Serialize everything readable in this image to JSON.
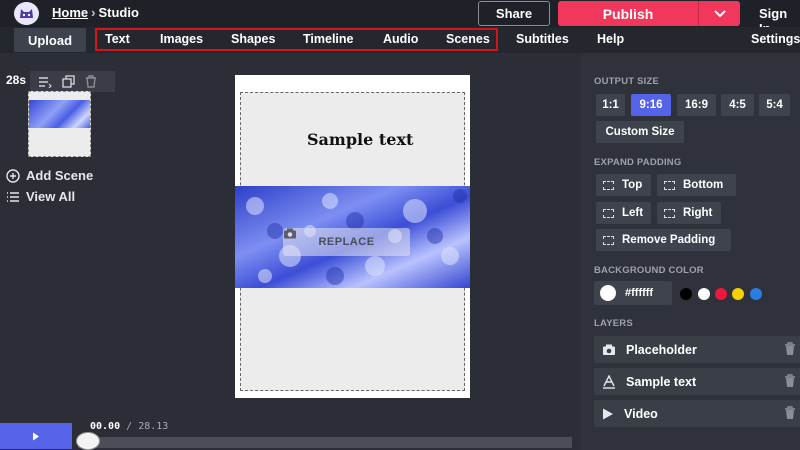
{
  "header": {
    "breadcrumb_home": "Home",
    "breadcrumb_separator": "›",
    "breadcrumb_current": "Studio",
    "share_label": "Share",
    "publish_label": "Publish",
    "signin_label": "Sign In"
  },
  "menu": {
    "upload_label": "Upload",
    "items": [
      "Text",
      "Images",
      "Shapes",
      "Timeline",
      "Audio",
      "Scenes",
      "Subtitles",
      "Help",
      "Settings"
    ]
  },
  "scenes": {
    "duration": "28s",
    "add_scene_label": "Add Scene",
    "view_all_label": "View All"
  },
  "canvas": {
    "sample_text": "Sample text",
    "replace_label": "REPLACE"
  },
  "timeline": {
    "current_time": "00.00",
    "separator": "/",
    "total_time": "28.13",
    "progress": 0
  },
  "right_panel": {
    "output_size_title": "OUTPUT SIZE",
    "sizes": [
      "1:1",
      "9:16",
      "16:9",
      "4:5",
      "5:4"
    ],
    "active_size": "9:16",
    "custom_size_label": "Custom Size",
    "expand_padding_title": "EXPAND PADDING",
    "padding_options": [
      "Top",
      "Bottom",
      "Left",
      "Right"
    ],
    "remove_padding_label": "Remove Padding",
    "background_color_title": "BACKGROUND COLOR",
    "background_color_value": "#ffffff",
    "color_presets": [
      "#000000",
      "#ffffff",
      "#e8193c",
      "#f5d000",
      "#2a7de1"
    ],
    "layers_title": "LAYERS",
    "layers": [
      {
        "label": "Placeholder",
        "icon": "image-placeholder-icon"
      },
      {
        "label": "Sample text",
        "icon": "text-icon"
      },
      {
        "label": "Video",
        "icon": "play-icon"
      }
    ]
  },
  "colors": {
    "accent": "#5563e8",
    "publish": "#f2375d",
    "highlight_border": "#d4141c"
  }
}
